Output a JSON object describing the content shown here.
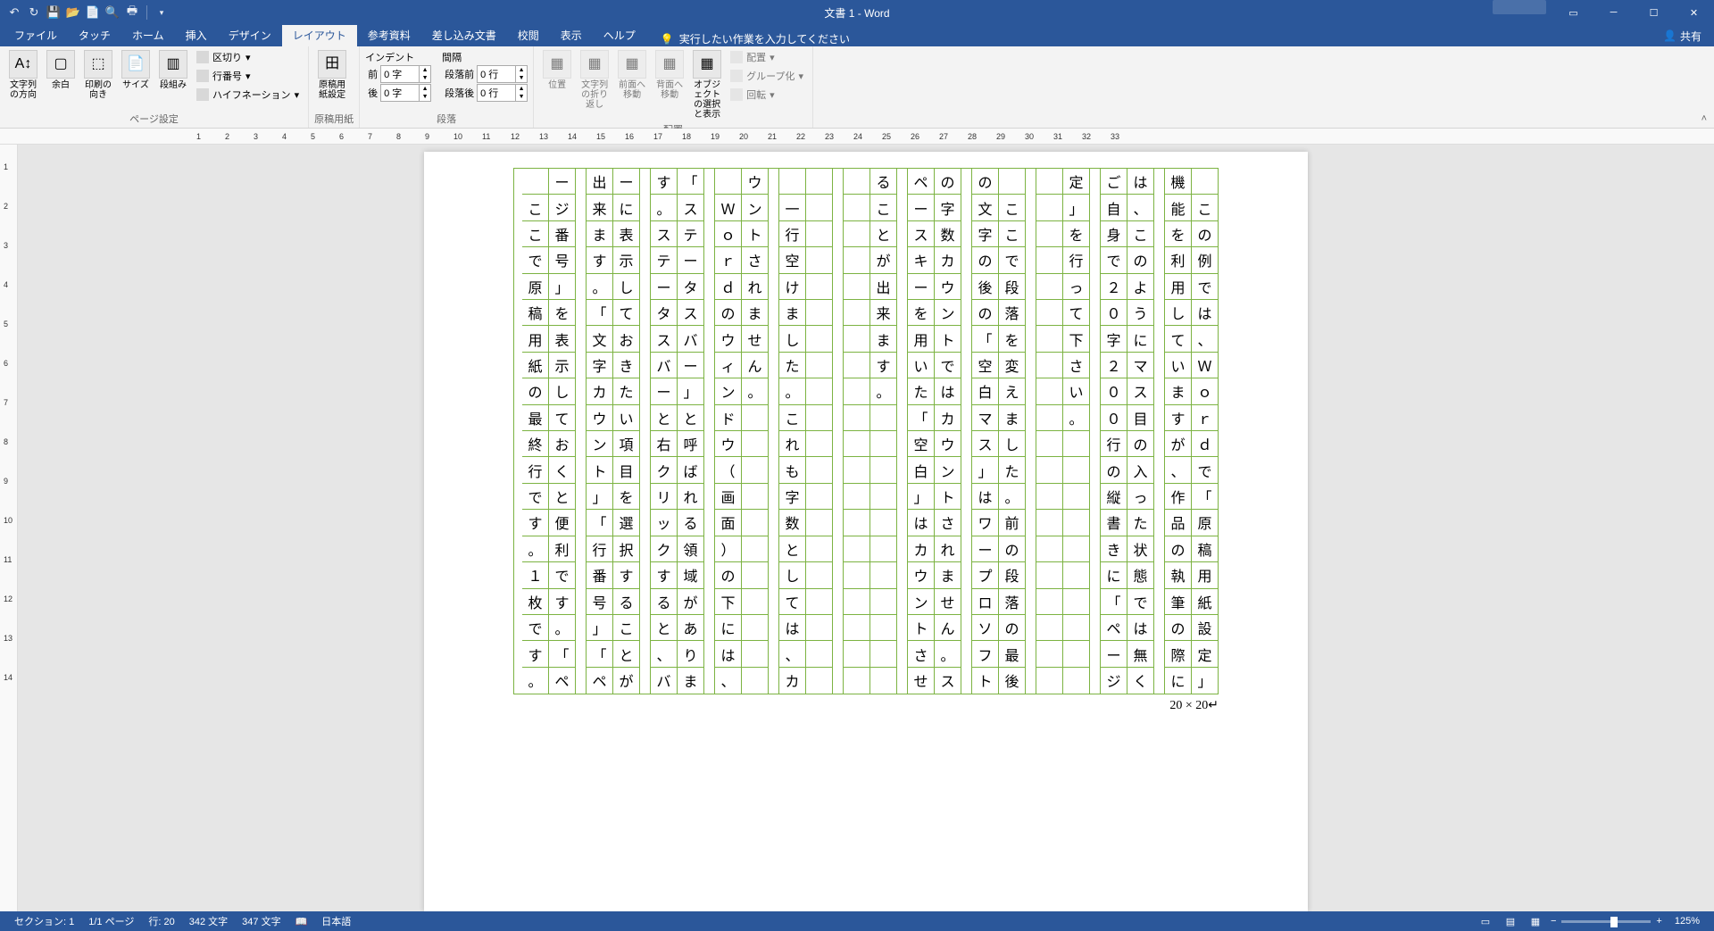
{
  "titlebar": {
    "doc_title": "文書 1 - Word"
  },
  "tabs": {
    "file": "ファイル",
    "touch": "タッチ",
    "home": "ホーム",
    "insert": "挿入",
    "design": "デザイン",
    "layout": "レイアウト",
    "references": "参考資料",
    "mailings": "差し込み文書",
    "review": "校閲",
    "view": "表示",
    "help": "ヘルプ",
    "tellme": "実行したい作業を入力してください",
    "share": "共有"
  },
  "ribbon": {
    "page_setup": {
      "label": "ページ設定",
      "text_direction": "文字列の方向",
      "margins": "余白",
      "orientation": "印刷の向き",
      "size": "サイズ",
      "columns": "段組み",
      "breaks": "区切り",
      "line_numbers": "行番号",
      "hyphenation": "ハイフネーション"
    },
    "genko": {
      "label": "原稿用紙",
      "settings": "原稿用紙設定"
    },
    "paragraph": {
      "label": "段落",
      "indent_header": "インデント",
      "spacing_header": "間隔",
      "before_label": "前",
      "after_label": "後",
      "indent_before": "0 字",
      "indent_after": "0 字",
      "spacing_before_label": "段落前",
      "spacing_after_label": "段落後",
      "spacing_before": "0 行",
      "spacing_after": "0 行"
    },
    "arrange": {
      "label": "配置",
      "position": "位置",
      "wrap": "文字列の折り返し",
      "bring_forward": "前面へ移動",
      "send_backward": "背面へ移動",
      "selection_pane": "オブジェクトの選択と表示",
      "align": "配置",
      "group": "グループ化",
      "rotate": "回転"
    }
  },
  "genko_columns": [
    "　この例では、Ｗｏｒｄで「原稿用紙設定」",
    "機能を利用していますが、作品の執筆の際に",
    "は、このようにマス目の入った状態では無く",
    "ご自身で２０字２００行の縦書きに「ページ",
    "定」を行って下さい。",
    "",
    "　ここで段落を変えました。前の段落の最後",
    "の文字の後の「空白マス」はワープロソフト",
    "の字数カウントではカウントされません。ス",
    "ペースキーを用いた「空白」はカウントさせ",
    "ることが出来ます。",
    "",
    "",
    "　一行空けました。これも字数としては、カ",
    "ウントされません。",
    "　Ｗｏｒｄのウィンドウ（画面）の下には、",
    "「ステータスバー」と呼ばれる領域がありま",
    "す。ステータスバーと右クリックすると、バ",
    "ーに表示しておきたい項目を選択することが",
    "出来ます。「文字カウント」「行番号」「ペ",
    "ージ番号」を表示しておくと便利です。「ペ",
    "　ここで原稿用紙の最終行です。１枚です。"
  ],
  "page_footer": "20 × 20",
  "status": {
    "section": "セクション: 1",
    "page": "1/1 ページ",
    "line": "行: 20",
    "words": "342 文字",
    "chars": "347 文字",
    "lang": "日本語",
    "zoom": "125%"
  }
}
